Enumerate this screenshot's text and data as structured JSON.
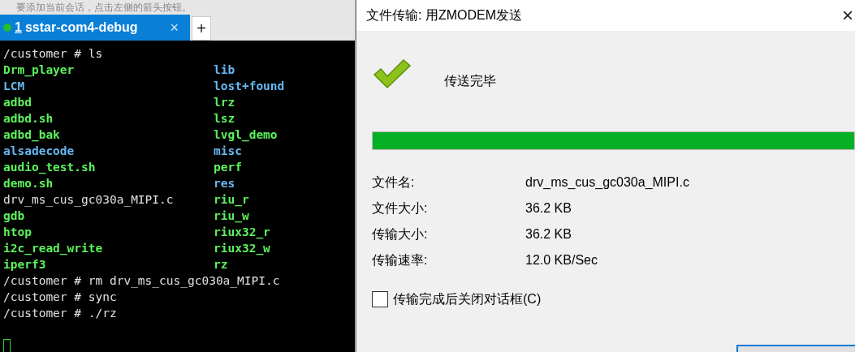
{
  "hint_bar": {
    "text": "要添加当前会话，点击左侧的箭头按钮。"
  },
  "tabs": [
    {
      "number": "1",
      "label": "sstar-com4-debug",
      "close": "×",
      "connected": true,
      "selected": true
    }
  ],
  "new_tab": "+",
  "terminal": {
    "lines": [
      {
        "kind": "command",
        "text": "/customer # ls"
      },
      {
        "kind": "listing",
        "cells": [
          {
            "text": "Drm_player",
            "color": "#5cf25c"
          },
          {
            "text": "lib",
            "color": "#66b8f2"
          }
        ]
      },
      {
        "kind": "listing",
        "cells": [
          {
            "text": "LCM",
            "color": "#66b8f2"
          },
          {
            "text": "lost+found",
            "color": "#66b8f2"
          }
        ]
      },
      {
        "kind": "listing",
        "cells": [
          {
            "text": "adbd",
            "color": "#5cf25c"
          },
          {
            "text": "lrz",
            "color": "#5cf25c"
          }
        ]
      },
      {
        "kind": "listing",
        "cells": [
          {
            "text": "adbd.sh",
            "color": "#5cf25c"
          },
          {
            "text": "lsz",
            "color": "#5cf25c"
          }
        ]
      },
      {
        "kind": "listing",
        "cells": [
          {
            "text": "adbd_bak",
            "color": "#5cf25c"
          },
          {
            "text": "lvgl_demo",
            "color": "#5cf25c"
          }
        ]
      },
      {
        "kind": "listing",
        "cells": [
          {
            "text": "alsadecode",
            "color": "#66b8f2"
          },
          {
            "text": "misc",
            "color": "#66b8f2"
          }
        ]
      },
      {
        "kind": "listing",
        "cells": [
          {
            "text": "audio_test.sh",
            "color": "#5cf25c"
          },
          {
            "text": "perf",
            "color": "#5cf25c"
          }
        ]
      },
      {
        "kind": "listing",
        "cells": [
          {
            "text": "demo.sh",
            "color": "#5cf25c"
          },
          {
            "text": "res",
            "color": "#66b8f2"
          }
        ]
      },
      {
        "kind": "listing",
        "cells": [
          {
            "text": "drv_ms_cus_gc030a_MIPI.c",
            "color": "#e0e0e0"
          },
          {
            "text": "riu_r",
            "color": "#5cf25c"
          }
        ]
      },
      {
        "kind": "listing",
        "cells": [
          {
            "text": "gdb",
            "color": "#5cf25c"
          },
          {
            "text": "riu_w",
            "color": "#5cf25c"
          }
        ]
      },
      {
        "kind": "listing",
        "cells": [
          {
            "text": "htop",
            "color": "#5cf25c"
          },
          {
            "text": "riux32_r",
            "color": "#5cf25c"
          }
        ]
      },
      {
        "kind": "listing",
        "cells": [
          {
            "text": "i2c_read_write",
            "color": "#5cf25c"
          },
          {
            "text": "riux32_w",
            "color": "#5cf25c"
          }
        ]
      },
      {
        "kind": "listing",
        "cells": [
          {
            "text": "iperf3",
            "color": "#5cf25c"
          },
          {
            "text": "rz",
            "color": "#5cf25c"
          }
        ]
      },
      {
        "kind": "command",
        "text": "/customer # rm drv_ms_cus_gc030a_MIPI.c"
      },
      {
        "kind": "command",
        "text": "/customer # sync"
      },
      {
        "kind": "command",
        "text": "/customer # ./rz"
      }
    ]
  },
  "dialog": {
    "title": "文件传输: 用ZMODEM发送",
    "close": "×",
    "status": "传送完毕",
    "progress": {
      "level": 1
    },
    "fields": [
      {
        "label": "文件名:",
        "value": "drv_ms_cus_gc030a_MIPI.c"
      },
      {
        "label": "文件大小:",
        "value": "36.2 KB"
      },
      {
        "label": "传输大小:",
        "value": "36.2 KB"
      },
      {
        "label": "传输速率:",
        "value": "12.0 KB/Sec"
      }
    ],
    "close_option": {
      "label": "传输完成后关闭对话框(C)",
      "checked": false
    }
  }
}
